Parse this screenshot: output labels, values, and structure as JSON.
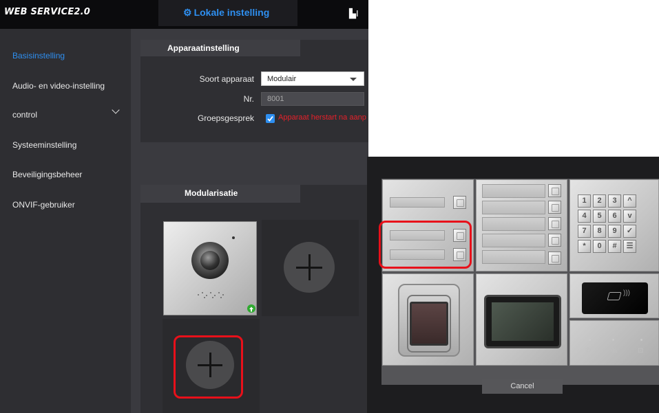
{
  "header": {
    "brand": "WEB SERVICE2.0",
    "active_tab": "Lokale instelling",
    "active_tab_icon": "gear-icon",
    "next_tab_fragment": "I",
    "next_tab_icon": "building-icon"
  },
  "sidebar": {
    "items": [
      {
        "label": "Basisinstelling",
        "active": true
      },
      {
        "label": "Audio- en video-instelling",
        "active": false
      },
      {
        "label": "control",
        "active": false,
        "expandable": true
      },
      {
        "label": "Systeeminstelling",
        "active": false
      },
      {
        "label": "Beveiligingsbeheer",
        "active": false
      },
      {
        "label": "ONVIF-gebruiker",
        "active": false
      }
    ]
  },
  "device_settings": {
    "tab": "Apparaatinstelling",
    "type_label": "Soort apparaat",
    "type_value": "Modulair",
    "nr_label": "Nr.",
    "nr_value": "8001",
    "group_label": "Groepsgesprek",
    "group_checked": true,
    "group_warning": "Apparaat herstart na aanp"
  },
  "modularisation": {
    "tab": "Modularisatie",
    "modules": [
      {
        "name": "camera-module",
        "has_upload_badge": true
      },
      {
        "name": "add-module",
        "icon": "plus-icon"
      },
      {
        "name": "add-module",
        "icon": "plus-icon",
        "highlighted": true
      }
    ]
  },
  "module_picker": {
    "keypad_keys": [
      "1",
      "2",
      "3",
      "^",
      "4",
      "5",
      "6",
      "v",
      "7",
      "8",
      "9",
      "✓",
      "*",
      "0",
      "#",
      "☰"
    ],
    "cancel_label": "Cancel"
  },
  "colors": {
    "accent": "#2e8ff0",
    "warning": "#e8202a",
    "highlight": "#e8101a"
  }
}
